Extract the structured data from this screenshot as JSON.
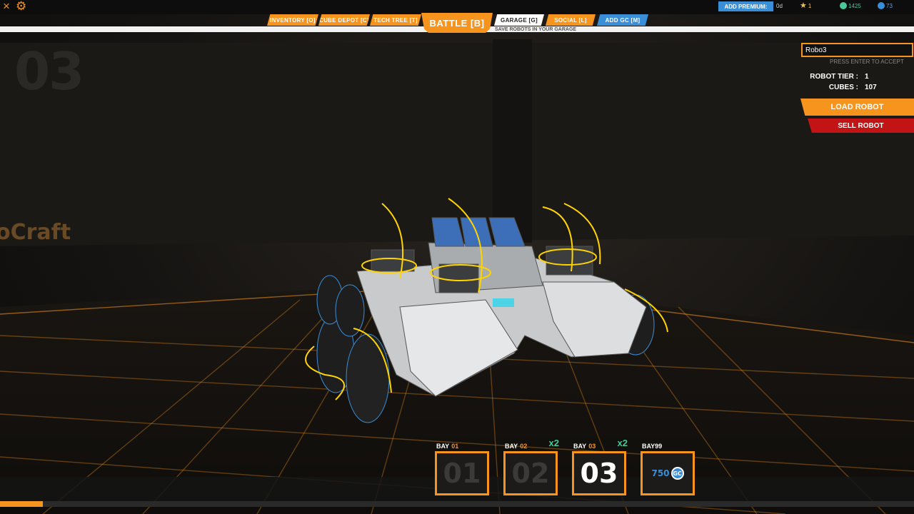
{
  "scene": {
    "big_bay_number": "03",
    "wall_brand": "oCraft"
  },
  "topbar": {
    "close_icon": "×",
    "gear_icon": "⚙",
    "tabs": [
      {
        "label": "INVENTORY [O]"
      },
      {
        "label": "CUBE DEPOT [C]"
      },
      {
        "label": "TECH TREE [T]"
      },
      {
        "label": "GARAGE [G]"
      },
      {
        "label": "SOCIAL [L]"
      },
      {
        "label": "ADD GC [M]"
      }
    ],
    "battle_label": "BATTLE [B]",
    "garage_hint": "SAVE ROBOTS IN YOUR GARAGE",
    "premium_label": "ADD PREMIUM:",
    "premium_days": "0d",
    "tier_stat": "1",
    "robits_stat": "1425",
    "gc_stat": "73",
    "colors": {
      "accent": "#f7941d",
      "blue": "#3a8ed8",
      "sell": "#c21414",
      "bonus": "#4cc79a"
    }
  },
  "panel": {
    "robot_name": "Robo3",
    "press_enter": "PRESS ENTER TO ACCEPT",
    "tier_label": "ROBOT TIER :",
    "tier_value": "1",
    "cubes_label": "CUBES :",
    "cubes_value": "107",
    "load_label": "LOAD ROBOT",
    "sell_label": "SELL ROBOT"
  },
  "bays": [
    {
      "prefix": "BAY",
      "num": "01",
      "display": "01",
      "mult": ""
    },
    {
      "prefix": "BAY",
      "num": "02",
      "display": "02",
      "mult": "x2"
    },
    {
      "prefix": "BAY",
      "num": "03",
      "display": "03",
      "mult": "x2"
    },
    {
      "prefix": "BAY99",
      "num": "",
      "price": "750",
      "gc": "GC"
    }
  ],
  "progress": {
    "fraction": 0.047
  }
}
